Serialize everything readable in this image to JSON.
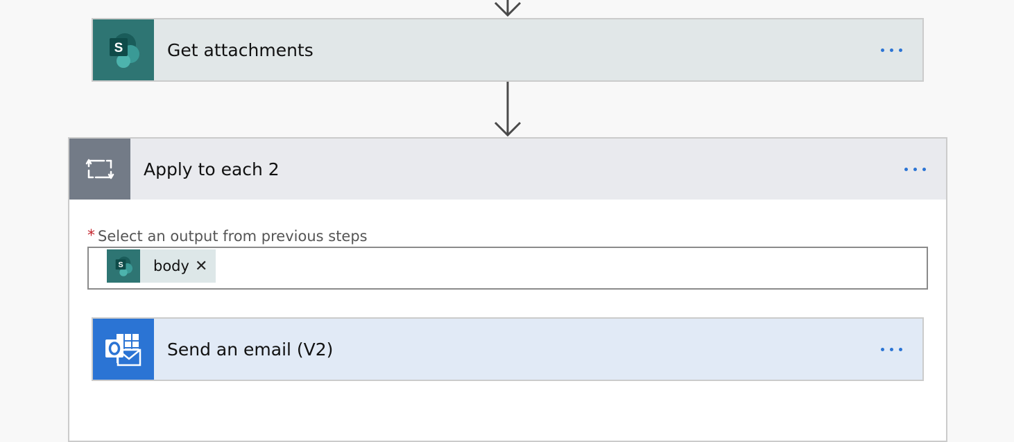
{
  "flow": {
    "get_attachments": {
      "title": "Get attachments",
      "icon": "sharepoint-icon",
      "more_icon": "ellipsis-icon"
    },
    "apply_to_each": {
      "title": "Apply to each 2",
      "icon": "loop-icon",
      "more_icon": "ellipsis-icon",
      "field": {
        "required_marker": "*",
        "label": "Select an output from previous steps",
        "token": {
          "icon": "sharepoint-icon",
          "label": "body",
          "remove_icon": "close-icon",
          "remove_glyph": "✕"
        }
      }
    },
    "send_email": {
      "title": "Send an email (V2)",
      "icon": "outlook-icon",
      "more_icon": "ellipsis-icon"
    }
  },
  "colors": {
    "sharepoint": "#2e7573",
    "loop": "#737b87",
    "outlook": "#2b74d4",
    "ellipsis": "#2b74d4",
    "required": "#c4262e"
  }
}
